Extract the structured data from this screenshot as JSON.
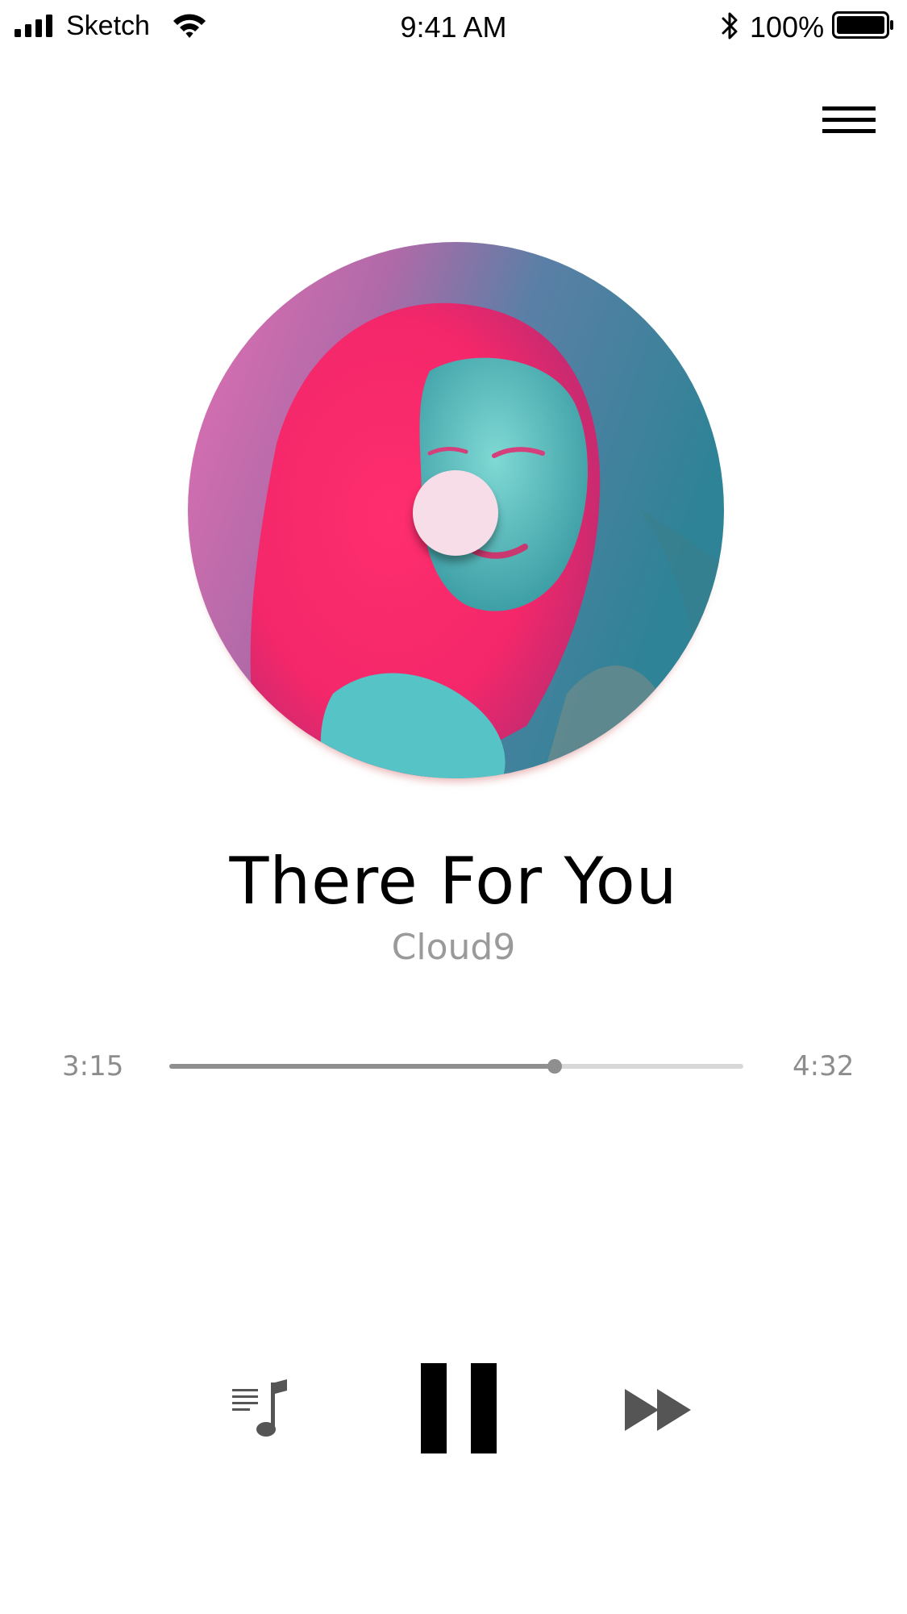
{
  "status_bar": {
    "carrier": "Sketch",
    "time": "9:41 AM",
    "battery": "100%"
  },
  "icons": {
    "signal": "signal-bars-icon",
    "wifi": "wifi-icon",
    "bluetooth": "bluetooth-icon",
    "battery": "battery-full-icon",
    "menu": "hamburger-menu-icon",
    "playlist": "playlist-music-note-icon",
    "pause": "pause-icon",
    "next": "fast-forward-icon"
  },
  "now_playing": {
    "title": "There For You",
    "artist": "Cloud9"
  },
  "progress": {
    "elapsed": "3:15",
    "total": "4:32",
    "fraction": 0.672
  },
  "colors": {
    "title": "#000000",
    "artist": "#9a9a9a",
    "time": "#8d8d8d",
    "progress_fill": "#8f8f8f",
    "progress_track": "#d8d8d8",
    "controls": "#000000",
    "secondary_controls": "#555555",
    "disc_hole": "#f7dde8"
  }
}
